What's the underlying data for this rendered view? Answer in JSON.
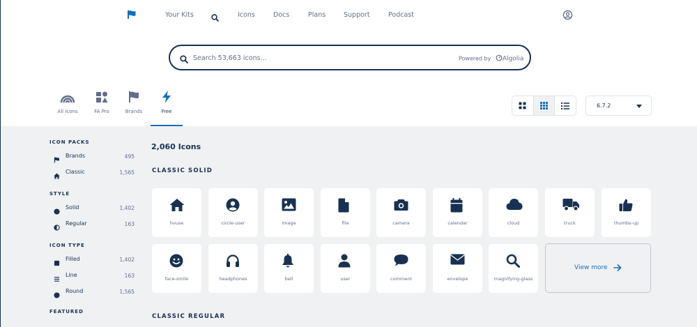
{
  "nav": {
    "links": [
      "Your Kits",
      "Icons",
      "Docs",
      "Plans",
      "Support",
      "Podcast"
    ]
  },
  "search": {
    "placeholder": "Search 53,663 icons...",
    "powered_by": "Powered by",
    "provider": "Algolia"
  },
  "tabs": [
    {
      "label": "All Icons",
      "icon": "rainbow-icon"
    },
    {
      "label": "FA Pro",
      "icon": "icons-grid-icon"
    },
    {
      "label": "Brands",
      "icon": "flag-icon"
    },
    {
      "label": "Free",
      "icon": "bolt-icon",
      "active": true
    }
  ],
  "view": {
    "version": "6.7.2"
  },
  "sidebar": {
    "groups": [
      {
        "heading": "ICON PACKS",
        "items": [
          {
            "label": "Brands",
            "count": "495",
            "icon": "flag-icon"
          },
          {
            "label": "Classic",
            "count": "1,565",
            "icon": "house-icon"
          }
        ]
      },
      {
        "heading": "STYLE",
        "items": [
          {
            "label": "Solid",
            "count": "1,402",
            "icon": "solid-circle-icon"
          },
          {
            "label": "Regular",
            "count": "163",
            "icon": "half-circle-icon"
          }
        ]
      },
      {
        "heading": "ICON TYPE",
        "items": [
          {
            "label": "Filled",
            "count": "1,402",
            "icon": "square-icon"
          },
          {
            "label": "Line",
            "count": "163",
            "icon": "lines-icon"
          },
          {
            "label": "Round",
            "count": "1,565",
            "icon": "circle-icon"
          }
        ]
      },
      {
        "heading": "FEATURED",
        "items": []
      }
    ]
  },
  "main": {
    "total": "2,060 Icons",
    "sections": [
      "CLASSIC SOLID",
      "CLASSIC REGULAR"
    ],
    "icons": [
      "house",
      "circle-user",
      "image",
      "file",
      "camera",
      "calendar",
      "cloud",
      "truck",
      "thumbs-up",
      "face-smile",
      "headphones",
      "bell",
      "user",
      "comment",
      "envelope",
      "magnifying-glass"
    ],
    "view_more": "View more"
  },
  "colors": {
    "navy": "#183153",
    "accent": "#146ebe",
    "muted": "#616d8a",
    "bg": "#f0f1f3"
  }
}
